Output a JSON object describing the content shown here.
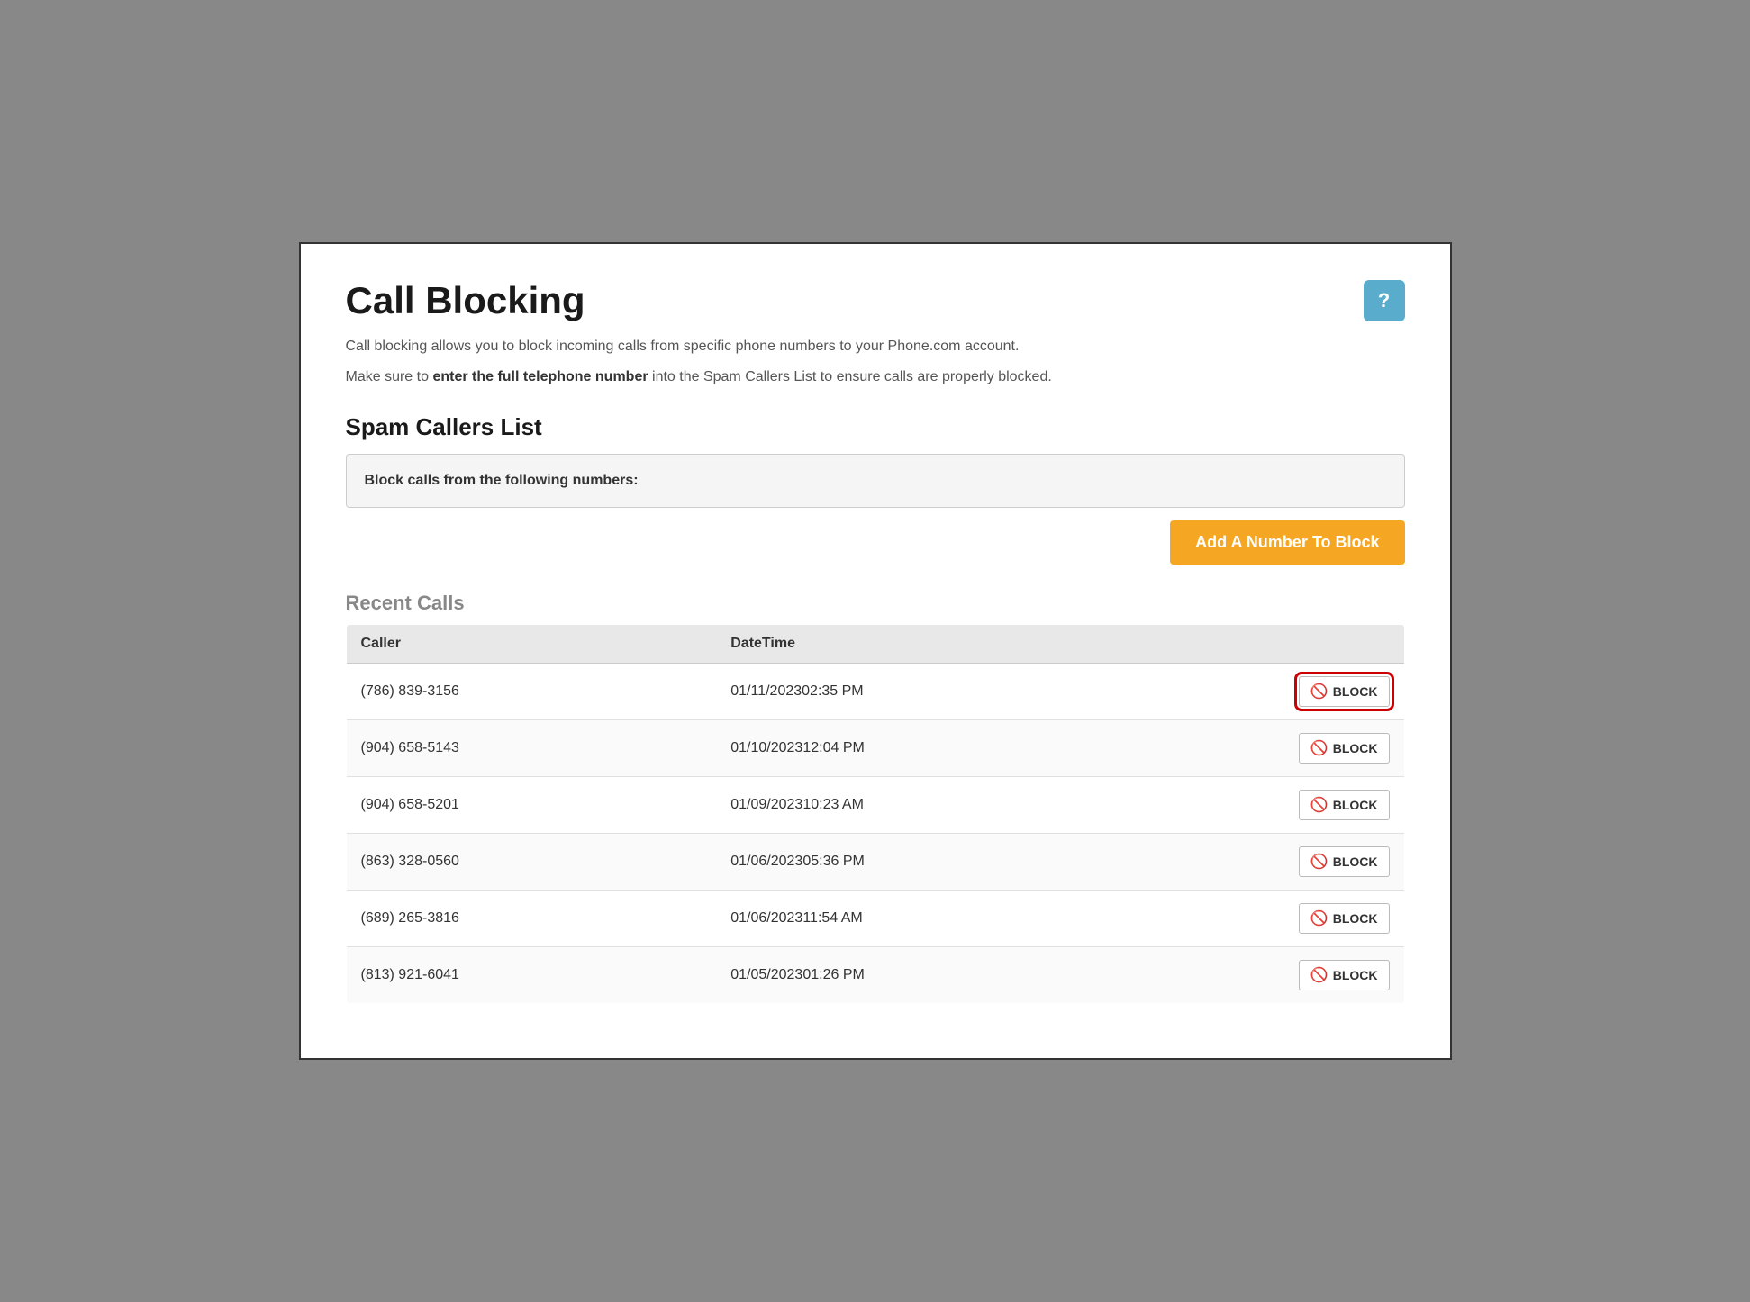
{
  "page": {
    "title": "Call Blocking",
    "help_button_label": "?",
    "description1": "Call blocking allows you to block incoming calls from specific phone numbers to your Phone.com account.",
    "description2_prefix": "Make sure to ",
    "description2_bold": "enter the full telephone number",
    "description2_suffix": " into the Spam Callers List to ensure calls are properly blocked.",
    "spam_callers_section": {
      "title": "Spam Callers List",
      "label": "Block calls from the following numbers:",
      "add_button_label": "Add A Number To Block"
    },
    "recent_calls_section": {
      "title": "Recent Calls",
      "columns": {
        "caller": "Caller",
        "datetime": "DateTime",
        "action": ""
      },
      "rows": [
        {
          "caller": "(786) 839-3156",
          "datetime": "01/11/202302:35 PM",
          "highlighted": true
        },
        {
          "caller": "(904) 658-5143",
          "datetime": "01/10/202312:04 PM",
          "highlighted": false
        },
        {
          "caller": "(904) 658-5201",
          "datetime": "01/09/202310:23 AM",
          "highlighted": false
        },
        {
          "caller": "(863) 328-0560",
          "datetime": "01/06/202305:36 PM",
          "highlighted": false
        },
        {
          "caller": "(689) 265-3816",
          "datetime": "01/06/202311:54 AM",
          "highlighted": false
        },
        {
          "caller": "(813) 921-6041",
          "datetime": "01/05/202301:26 PM",
          "highlighted": false
        }
      ],
      "block_button_label": "BLOCK"
    }
  },
  "colors": {
    "help_button_bg": "#5aaccc",
    "add_button_bg": "#f5a623",
    "highlight_outline": "#cc0000"
  }
}
